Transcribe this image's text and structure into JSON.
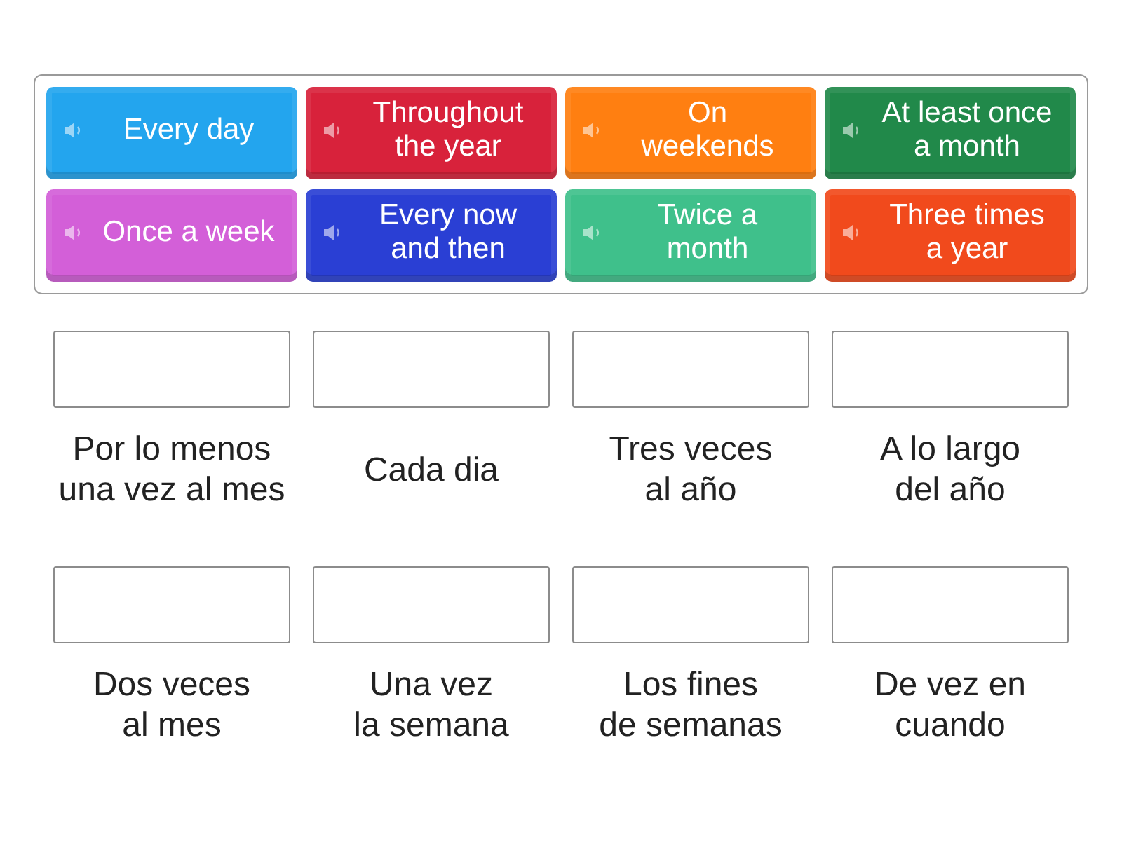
{
  "tiles": [
    {
      "lines": [
        "Every day"
      ],
      "color": "#23a5ee"
    },
    {
      "lines": [
        "Throughout",
        "the year"
      ],
      "color": "#d8223b"
    },
    {
      "lines": [
        "On",
        "weekends"
      ],
      "color": "#ff7f11"
    },
    {
      "lines": [
        "At least once",
        "a month"
      ],
      "color": "#21894a"
    },
    {
      "lines": [
        "Once a week"
      ],
      "color": "#d35fd8"
    },
    {
      "lines": [
        "Every now",
        "and then"
      ],
      "color": "#2a3fd4"
    },
    {
      "lines": [
        "Twice a",
        "month"
      ],
      "color": "#3fc08b"
    },
    {
      "lines": [
        "Three times",
        "a year"
      ],
      "color": "#f14a1c"
    }
  ],
  "slots": [
    {
      "label": [
        "Por lo menos",
        "una vez al mes"
      ]
    },
    {
      "label": [
        "Cada dia"
      ]
    },
    {
      "label": [
        "Tres veces",
        "al año"
      ]
    },
    {
      "label": [
        "A lo largo",
        "del año"
      ]
    },
    {
      "label": [
        "Dos veces",
        "al mes"
      ]
    },
    {
      "label": [
        "Una vez",
        "la semana"
      ]
    },
    {
      "label": [
        "Los fines",
        "de semanas"
      ]
    },
    {
      "label": [
        "De vez en",
        "cuando"
      ]
    }
  ]
}
